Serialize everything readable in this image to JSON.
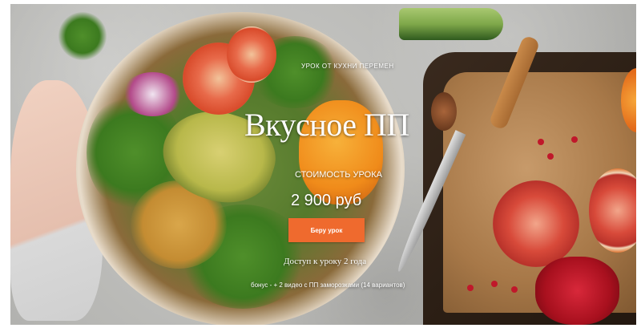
{
  "hero": {
    "eyebrow": "УРОК ОТ КУХНИ ПЕРЕМЕН",
    "title": "Вкусное ПП",
    "price_label": "СТОИМОСТЬ УРОКА",
    "price_value": "2 900 руб",
    "cta_label": "Беру урок",
    "access_text": "Доступ к уроку 2 года",
    "bonus_text": "бонус - + 2 видео с ПП заморозками (14 вариантов)"
  },
  "colors": {
    "cta_background": "#ef6a2e",
    "text": "#ffffff"
  }
}
